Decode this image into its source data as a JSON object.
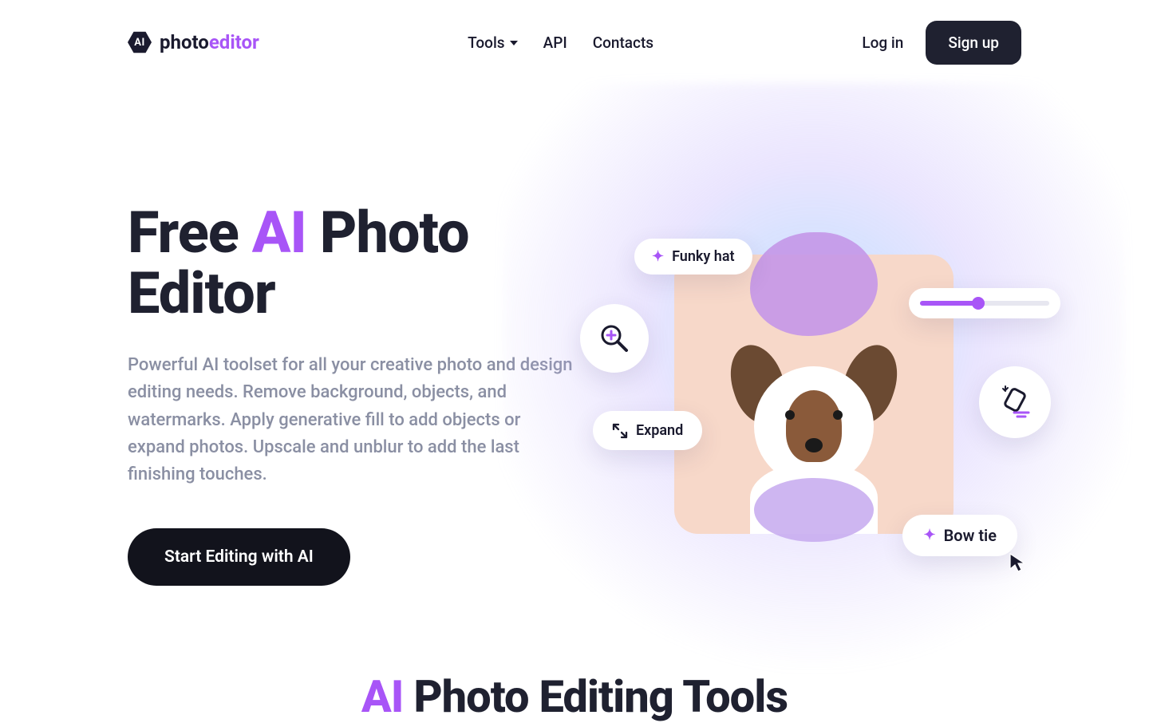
{
  "brand": {
    "badge_text": "AI",
    "word1": "photo",
    "word2": "editor"
  },
  "nav": {
    "tools": "Tools",
    "api": "API",
    "contacts": "Contacts"
  },
  "auth": {
    "login": "Log in",
    "signup": "Sign up"
  },
  "hero": {
    "h1_pre": "Free ",
    "h1_accent": "AI",
    "h1_post": " Photo Editor",
    "sub": "Powerful AI toolset for all your creative photo and design editing needs. Remove background, objects, and watermarks. Apply generative fill to add objects or expand photos. Upscale and unblur to add the last finishing touches.",
    "cta": "Start Editing with AI"
  },
  "visual": {
    "chip_funky": "Funky hat",
    "chip_expand": "Expand",
    "chip_bowtie": "Bow tie",
    "slider_value_percent": 45
  },
  "section2": {
    "accent": "AI",
    "rest": " Photo Editing Tools"
  },
  "colors": {
    "accent": "#a855f7",
    "dark": "#1f2130"
  }
}
